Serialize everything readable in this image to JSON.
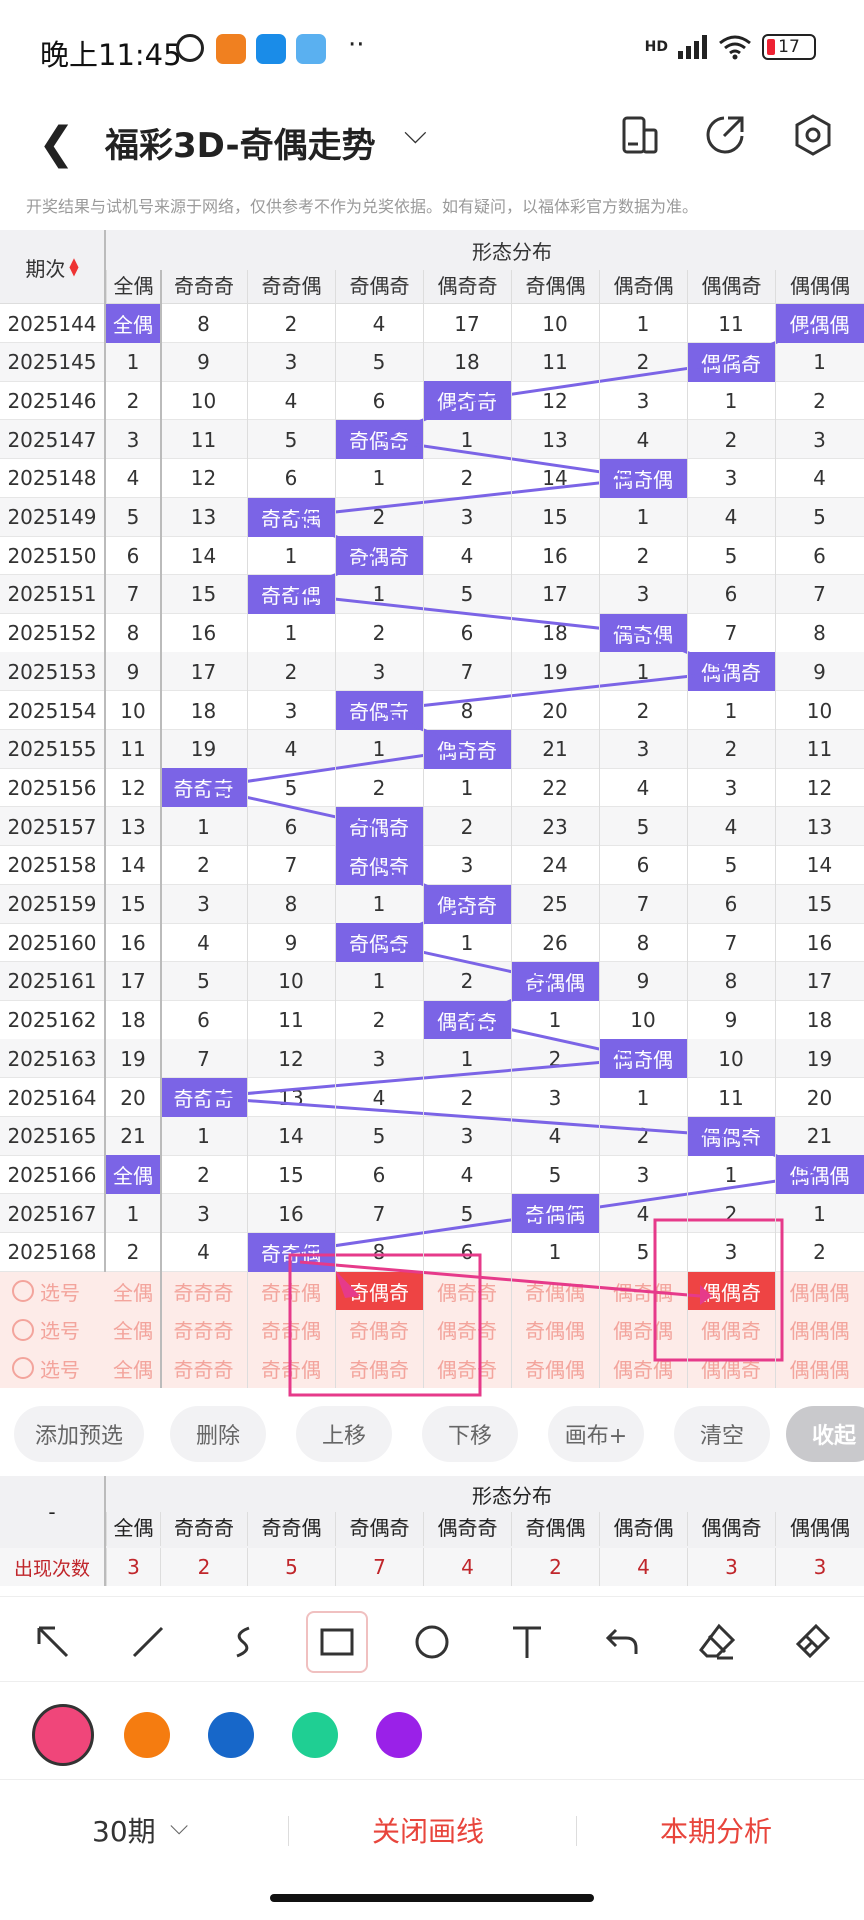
{
  "status_bar": {
    "time": "晚上11:45",
    "battery": "17",
    "network": "HD"
  },
  "header": {
    "back_icon": "back-icon",
    "title": "福彩3D-奇偶走势",
    "icons": [
      "phone-layout-icon",
      "share-icon",
      "settings-icon"
    ]
  },
  "disclaimer": "开奖结果与试机号来源于网络，仅供参考不作为兑奖依据。如有疑问，以福体彩官方数据为准。",
  "table": {
    "period_header": "期次",
    "group_header": "形态分布",
    "columns": [
      "全偶",
      "奇奇奇",
      "奇奇偶",
      "奇偶奇",
      "偶奇奇",
      "奇偶偶",
      "偶奇偶",
      "偶偶奇",
      "偶偶偶"
    ],
    "rows": [
      {
        "period": "2025144",
        "cells": [
          "全偶",
          "8",
          "2",
          "4",
          "17",
          "10",
          "1",
          "11",
          "偶偶偶"
        ],
        "hit": [
          0,
          8
        ]
      },
      {
        "period": "2025145",
        "cells": [
          "1",
          "9",
          "3",
          "5",
          "18",
          "11",
          "2",
          "偶偶奇",
          "1"
        ],
        "hit": [
          7
        ]
      },
      {
        "period": "2025146",
        "cells": [
          "2",
          "10",
          "4",
          "6",
          "偶奇奇",
          "12",
          "3",
          "1",
          "2"
        ],
        "hit": [
          4
        ]
      },
      {
        "period": "2025147",
        "cells": [
          "3",
          "11",
          "5",
          "奇偶奇",
          "1",
          "13",
          "4",
          "2",
          "3"
        ],
        "hit": [
          3
        ]
      },
      {
        "period": "2025148",
        "cells": [
          "4",
          "12",
          "6",
          "1",
          "2",
          "14",
          "偶奇偶",
          "3",
          "4"
        ],
        "hit": [
          6
        ]
      },
      {
        "period": "2025149",
        "cells": [
          "5",
          "13",
          "奇奇偶",
          "2",
          "3",
          "15",
          "1",
          "4",
          "5"
        ],
        "hit": [
          2
        ]
      },
      {
        "period": "2025150",
        "cells": [
          "6",
          "14",
          "1",
          "奇偶奇",
          "4",
          "16",
          "2",
          "5",
          "6"
        ],
        "hit": [
          3
        ]
      },
      {
        "period": "2025151",
        "cells": [
          "7",
          "15",
          "奇奇偶",
          "1",
          "5",
          "17",
          "3",
          "6",
          "7"
        ],
        "hit": [
          2
        ]
      },
      {
        "period": "2025152",
        "cells": [
          "8",
          "16",
          "1",
          "2",
          "6",
          "18",
          "偶奇偶",
          "7",
          "8"
        ],
        "hit": [
          6
        ]
      },
      {
        "period": "2025153",
        "cells": [
          "9",
          "17",
          "2",
          "3",
          "7",
          "19",
          "1",
          "偶偶奇",
          "9"
        ],
        "hit": [
          7
        ]
      },
      {
        "period": "2025154",
        "cells": [
          "10",
          "18",
          "3",
          "奇偶奇",
          "8",
          "20",
          "2",
          "1",
          "10"
        ],
        "hit": [
          3
        ]
      },
      {
        "period": "2025155",
        "cells": [
          "11",
          "19",
          "4",
          "1",
          "偶奇奇",
          "21",
          "3",
          "2",
          "11"
        ],
        "hit": [
          4
        ]
      },
      {
        "period": "2025156",
        "cells": [
          "12",
          "奇奇奇",
          "5",
          "2",
          "1",
          "22",
          "4",
          "3",
          "12"
        ],
        "hit": [
          1
        ]
      },
      {
        "period": "2025157",
        "cells": [
          "13",
          "1",
          "6",
          "奇偶奇",
          "2",
          "23",
          "5",
          "4",
          "13"
        ],
        "hit": [
          3
        ]
      },
      {
        "period": "2025158",
        "cells": [
          "14",
          "2",
          "7",
          "奇偶奇",
          "3",
          "24",
          "6",
          "5",
          "14"
        ],
        "hit": [
          3
        ]
      },
      {
        "period": "2025159",
        "cells": [
          "15",
          "3",
          "8",
          "1",
          "偶奇奇",
          "25",
          "7",
          "6",
          "15"
        ],
        "hit": [
          4
        ]
      },
      {
        "period": "2025160",
        "cells": [
          "16",
          "4",
          "9",
          "奇偶奇",
          "1",
          "26",
          "8",
          "7",
          "16"
        ],
        "hit": [
          3
        ]
      },
      {
        "period": "2025161",
        "cells": [
          "17",
          "5",
          "10",
          "1",
          "2",
          "奇偶偶",
          "9",
          "8",
          "17"
        ],
        "hit": [
          5
        ]
      },
      {
        "period": "2025162",
        "cells": [
          "18",
          "6",
          "11",
          "2",
          "偶奇奇",
          "1",
          "10",
          "9",
          "18"
        ],
        "hit": [
          4
        ]
      },
      {
        "period": "2025163",
        "cells": [
          "19",
          "7",
          "12",
          "3",
          "1",
          "2",
          "偶奇偶",
          "10",
          "19"
        ],
        "hit": [
          6
        ]
      },
      {
        "period": "2025164",
        "cells": [
          "20",
          "奇奇奇",
          "13",
          "4",
          "2",
          "3",
          "1",
          "11",
          "20"
        ],
        "hit": [
          1
        ]
      },
      {
        "period": "2025165",
        "cells": [
          "21",
          "1",
          "14",
          "5",
          "3",
          "4",
          "2",
          "偶偶奇",
          "21"
        ],
        "hit": [
          7
        ]
      },
      {
        "period": "2025166",
        "cells": [
          "全偶",
          "2",
          "15",
          "6",
          "4",
          "5",
          "3",
          "1",
          "偶偶偶"
        ],
        "hit": [
          0,
          8
        ]
      },
      {
        "period": "2025167",
        "cells": [
          "1",
          "3",
          "16",
          "7",
          "5",
          "奇偶偶",
          "4",
          "2",
          "1"
        ],
        "hit": [
          5
        ]
      },
      {
        "period": "2025168",
        "cells": [
          "2",
          "4",
          "奇奇偶",
          "8",
          "6",
          "1",
          "5",
          "3",
          "2"
        ],
        "hit": [
          2
        ]
      }
    ],
    "select_label": "选号",
    "select_rows": [
      {
        "cells": [
          "全偶",
          "奇奇奇",
          "奇奇偶",
          "奇偶奇",
          "偶奇奇",
          "奇偶偶",
          "偶奇偶",
          "偶偶奇",
          "偶偶偶"
        ],
        "hit": [
          3,
          7
        ]
      },
      {
        "cells": [
          "全偶",
          "奇奇奇",
          "奇奇偶",
          "奇偶奇",
          "偶奇奇",
          "奇偶偶",
          "偶奇偶",
          "偶偶奇",
          "偶偶偶"
        ],
        "hit": []
      },
      {
        "cells": [
          "全偶",
          "奇奇奇",
          "奇奇偶",
          "奇偶奇",
          "偶奇奇",
          "奇偶偶",
          "偶奇偶",
          "偶偶奇",
          "偶偶偶"
        ],
        "hit": []
      }
    ]
  },
  "actions": [
    "添加预选",
    "删除",
    "上移",
    "下移",
    "画布+",
    "清空",
    "收起"
  ],
  "summary": {
    "left_header": "-",
    "group_header": "形态分布",
    "columns": [
      "全偶",
      "奇奇奇",
      "奇奇偶",
      "奇偶奇",
      "偶奇奇",
      "奇偶偶",
      "偶奇偶",
      "偶偶奇",
      "偶偶偶"
    ],
    "row_label": "出现次数",
    "counts": [
      "3",
      "2",
      "5",
      "7",
      "4",
      "2",
      "4",
      "3",
      "3"
    ]
  },
  "tools": [
    "arrow-tool-icon",
    "line-tool-icon",
    "freehand-tool-icon",
    "rectangle-tool-icon",
    "circle-tool-icon",
    "text-tool-icon",
    "undo-icon",
    "eraser-icon",
    "clear-brush-icon"
  ],
  "colors": [
    "#f0467a",
    "#f57c10",
    "#1767c9",
    "#1fcf93",
    "#9a21e8"
  ],
  "bottom": {
    "period_select": "30期",
    "close_lines": "关闭画线",
    "analysis": "本期分析"
  },
  "theme": {
    "hit_color": "#7b64e6",
    "accent_red": "#e8453c"
  }
}
